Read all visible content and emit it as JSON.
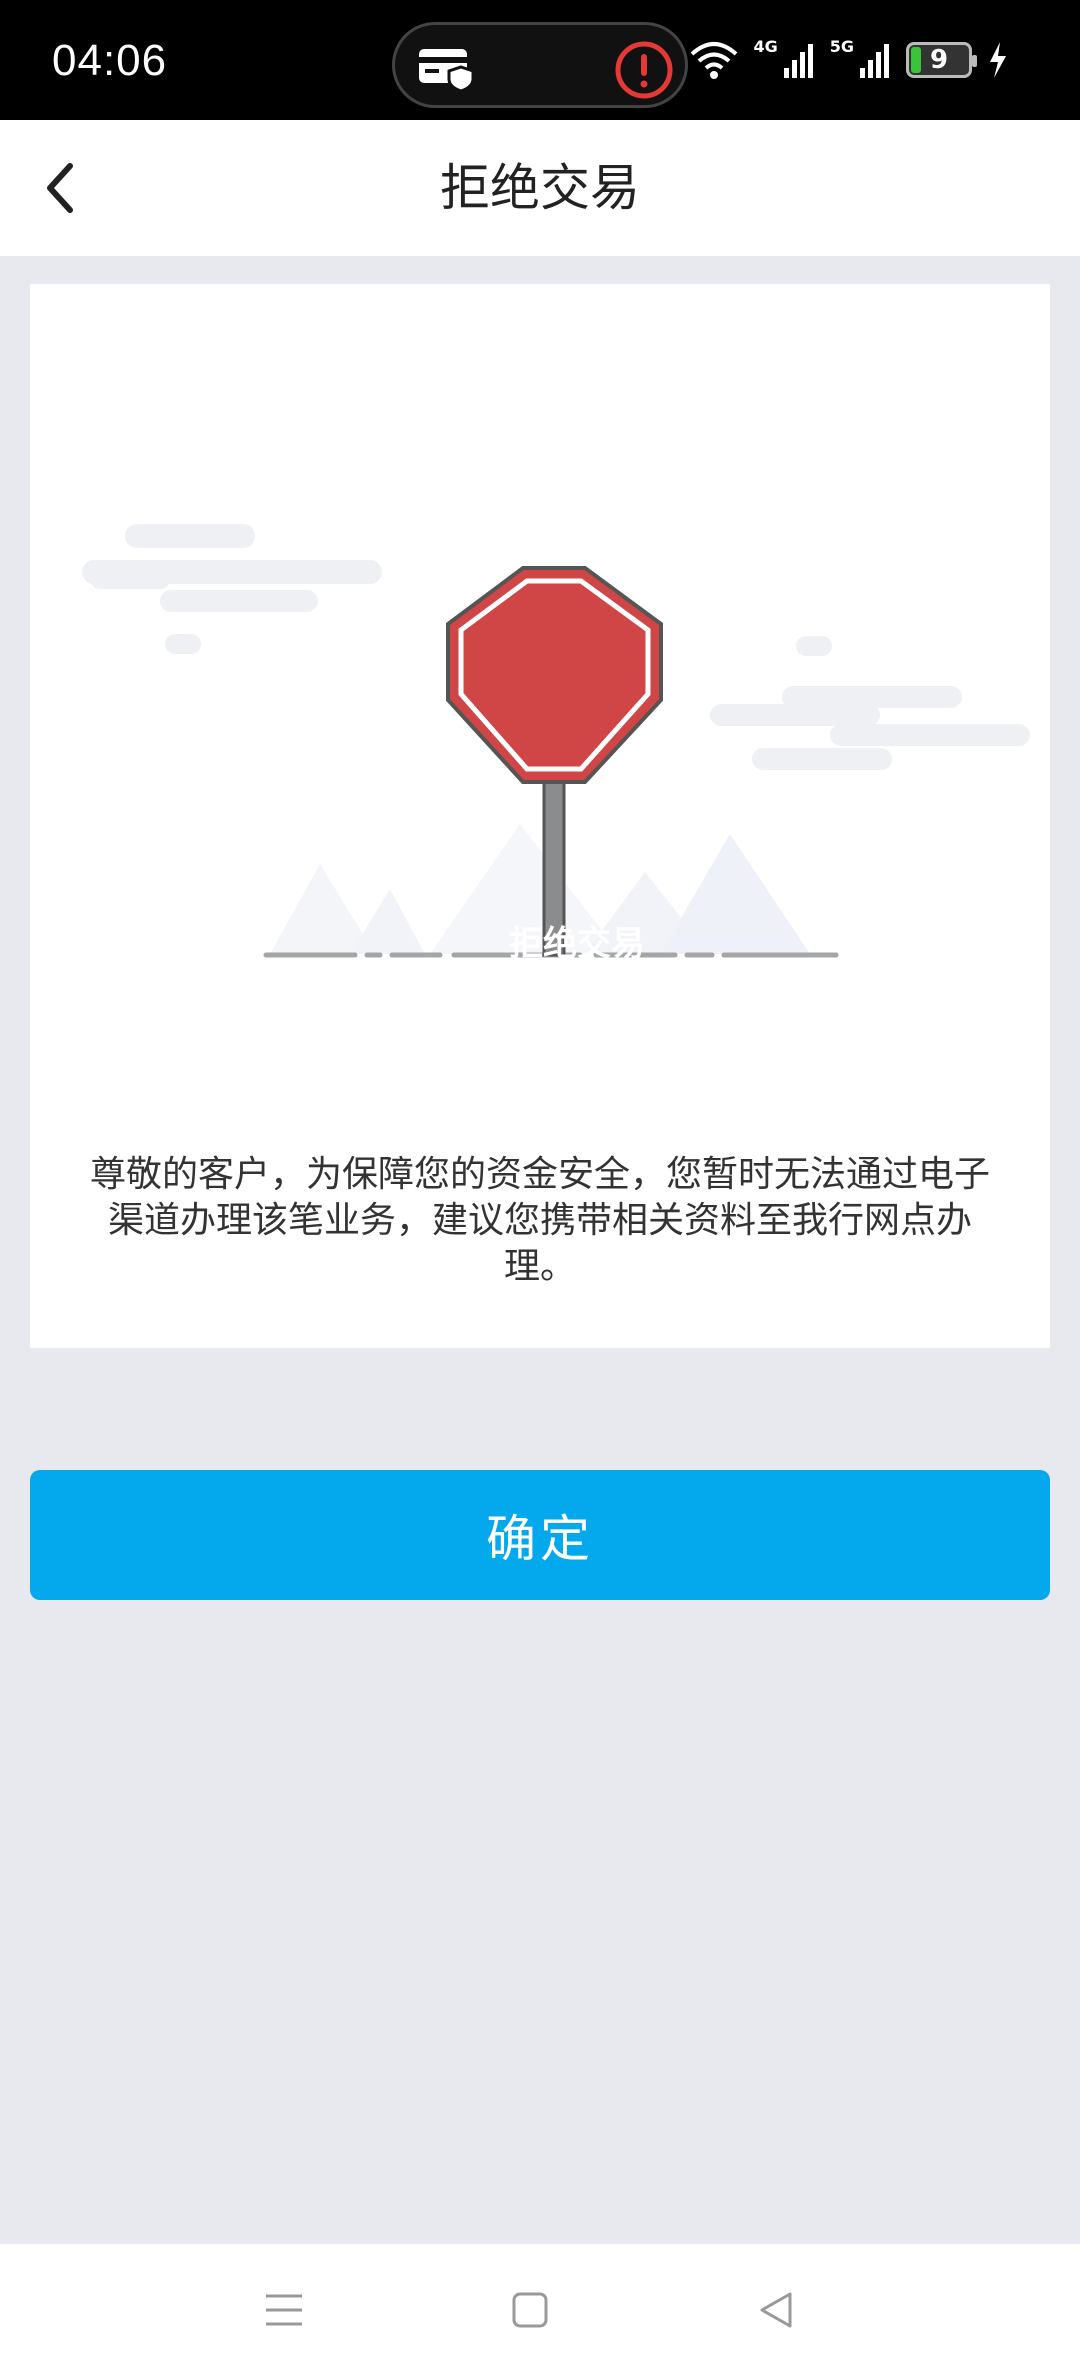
{
  "status_bar": {
    "time": "04:06",
    "network_1": "4G",
    "network_2": "5G",
    "battery_level": "9",
    "icons": [
      "card-shield-icon",
      "alert-icon",
      "wifi-icon",
      "signal-icon",
      "battery-icon",
      "charging-icon"
    ],
    "alert_color": "#e53935"
  },
  "header": {
    "title": "拒绝交易",
    "back_icon": "chevron-left-icon"
  },
  "illustration": {
    "sign_text": "拒绝交易",
    "sign_color": "#d04545"
  },
  "message": "尊敬的客户，为保障您的资金安全，您暂时无法通过电子渠道办理该笔业务，建议您携带相关资料至我行网点办理。",
  "confirm_button": {
    "label": "确定",
    "color": "#03a9ec"
  },
  "nav_bar": {
    "icons": [
      "menu-icon",
      "home-square-icon",
      "back-triangle-icon"
    ]
  }
}
